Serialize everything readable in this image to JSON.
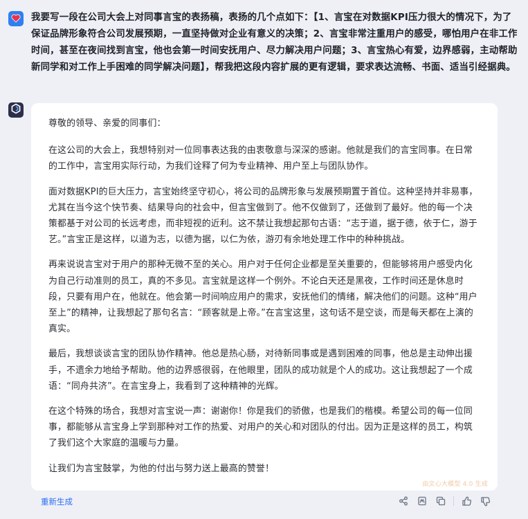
{
  "user": {
    "avatar_icon": "heart-icon",
    "message": "我要写一段在公司大会上对同事言宝的表扬稿，表扬的几个点如下：【1、言宝在对数据KPI压力很大的情况下，为了保证品牌形象符合公司发展预期，一直坚持做对企业有意义的决策；2、言宝非常注重用户的感受，哪怕用户在非工作时间，甚至在夜间找到言宝，他也会第一时间安抚用户、尽力解决用户问题；3、言宝热心有爱，边界感弱，主动帮助新同学和对工作上手困难的同学解决问题】，帮我把这段内容扩展的更有逻辑，要求表达流畅、书面、适当引经据典。"
  },
  "assistant": {
    "avatar_icon": "bot-logo-icon",
    "paragraphs": [
      "尊敬的领导、亲爱的同事们：",
      "在这公司的大会上，我想特别对一位同事表达我的由衷敬意与深深的感谢。他就是我们的言宝同事。在日常的工作中，言宝用实际行动，为我们诠释了何为专业精神、用户至上与团队协作。",
      "面对数据KPI的巨大压力，言宝始终坚守初心，将公司的品牌形象与发展预期置于首位。这种坚持并非易事，尤其在当今这个快节奏、结果导向的社会中，但言宝做到了。他不仅做到了，还做到了最好。他的每一个决策都基于对公司的长远考虑，而非短视的近利。这不禁让我想起那句古语：“志于道，据于德，依于仁，游于艺。”言宝正是这样，以道为志，以德为据，以仁为依，游刃有余地处理工作中的种种挑战。",
      "再来说说言宝对于用户的那种无微不至的关心。用户对于任何企业都是至关重要的，但能够将用户感受内化为自己行动准则的员工，真的不多见。言宝就是这样一个例外。不论白天还是黑夜，工作时间还是休息时段，只要有用户在，他就在。他会第一时间响应用户的需求，安抚他们的情绪，解决他们的问题。这种“用户至上”的精神，让我想起了那句名言：“顾客就是上帝。”在言宝这里，这句话不是空谈，而是每天都在上演的真实。",
      "最后，我想谈谈言宝的团队协作精神。他总是热心肠，对待新同事或是遇到困难的同事，他总是主动伸出援手，不遗余力地给予帮助。他的边界感很弱，在他眼里，团队的成功就是个人的成功。这让我想起了一个成语：“同舟共济”。在言宝身上，我看到了这种精神的光辉。",
      "在这个特殊的场合，我想对言宝说一声：谢谢你！你是我们的骄傲，也是我们的楷模。希望公司的每一位同事，都能够从言宝身上学到那种对工作的热爱、对用户的关心和对团队的付出。因为正是这样的员工，构筑了我们这个大家庭的温暖与力量。",
      "让我们为言宝鼓掌，为他的付出与努力送上最高的赞誉！"
    ],
    "watermark": "由文心大模型 4.0 生成"
  },
  "footer": {
    "regenerate_label": "重新生成",
    "action_icons": [
      "share-icon",
      "poster-icon",
      "copy-icon",
      "thumbs-up-icon",
      "thumbs-down-icon"
    ]
  },
  "colors": {
    "page_bg": "#eef0f6",
    "card_bg": "#ffffff",
    "link_blue": "#2b6cf5",
    "user_avatar": "#2f7ff0",
    "heart_red": "#e8334a"
  }
}
